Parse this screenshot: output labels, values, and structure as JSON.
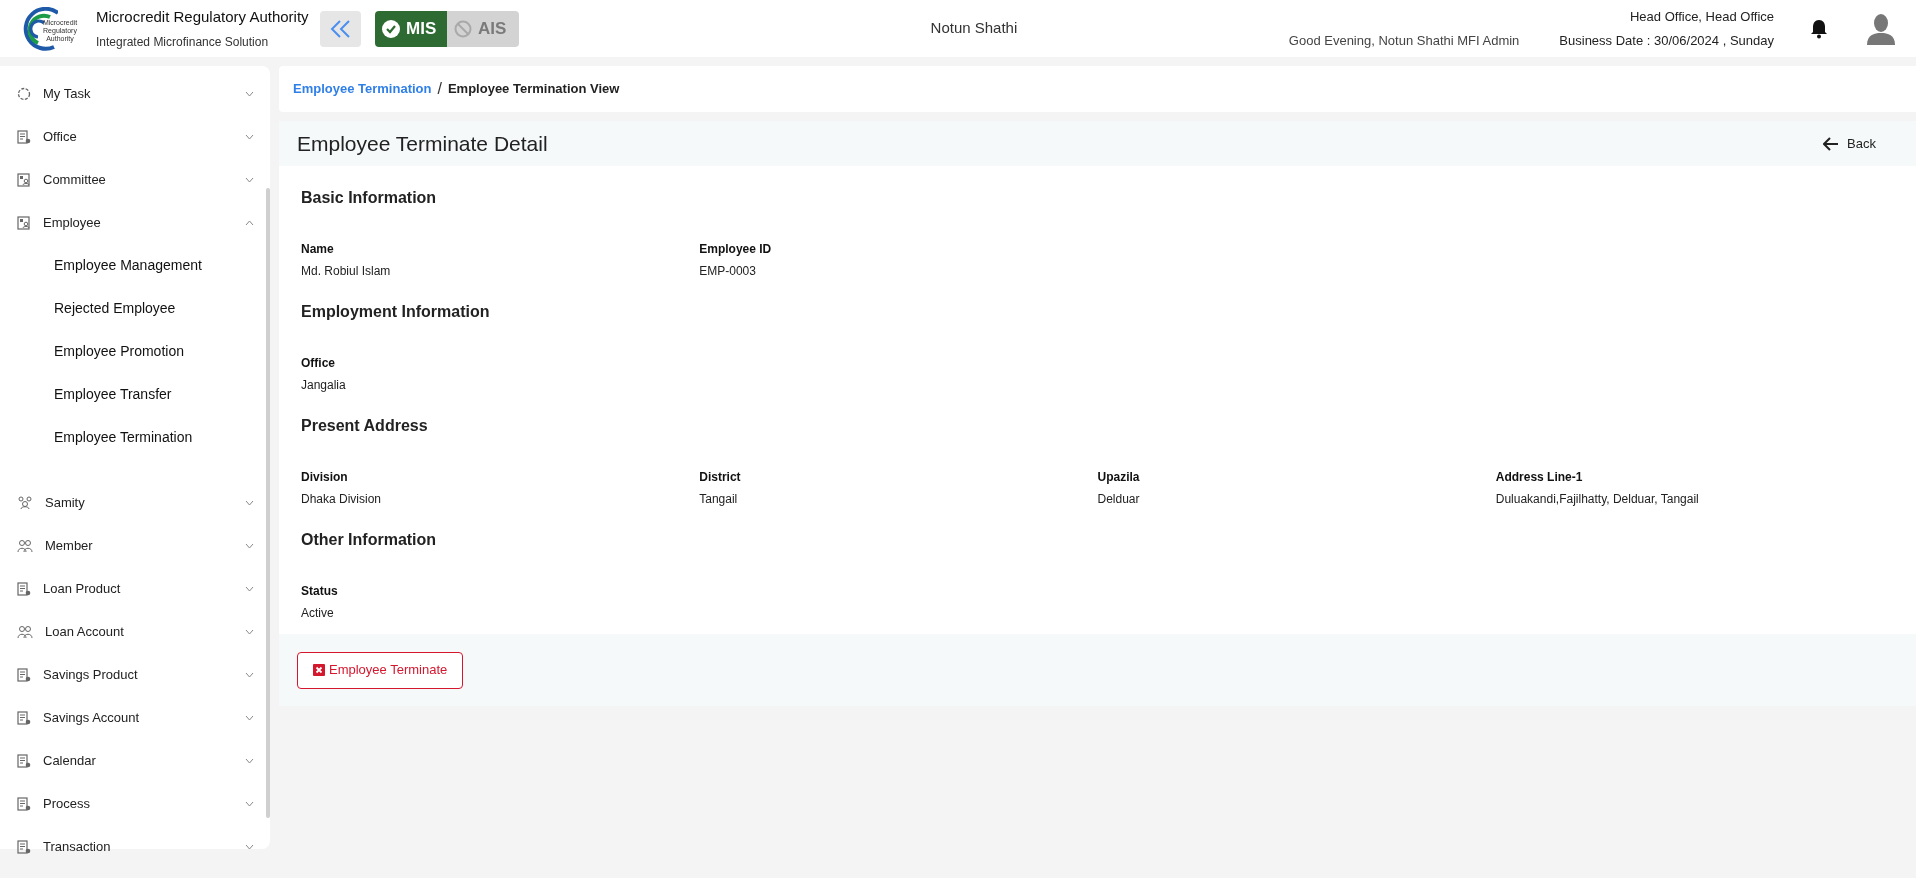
{
  "header": {
    "org_title": "Microcredit Regulatory Authority",
    "org_subtitle": "Integrated Microfinance Solution",
    "logo_text": "Microcredit Regulatory Authority",
    "modules": [
      {
        "label": "MIS",
        "selected": true
      },
      {
        "label": "AIS",
        "selected": false
      }
    ],
    "company": "Notun Shathi",
    "greeting": "Good Evening, Notun Shathi MFI Admin",
    "office": "Head Office, Head Office",
    "business_date": "Business Date : 30/06/2024 , Sunday"
  },
  "sidebar": {
    "items": [
      {
        "label": "My Task",
        "kind": "task",
        "expanded": false
      },
      {
        "label": "Office",
        "kind": "doc",
        "expanded": false
      },
      {
        "label": "Committee",
        "kind": "board",
        "expanded": false
      },
      {
        "label": "Employee",
        "kind": "board",
        "expanded": true,
        "children": [
          {
            "label": "Employee Management"
          },
          {
            "label": "Rejected Employee"
          },
          {
            "label": "Employee Promotion"
          },
          {
            "label": "Employee Transfer"
          },
          {
            "label": "Employee Termination"
          }
        ]
      },
      {
        "label": "Samity",
        "kind": "samity",
        "expanded": false
      },
      {
        "label": "Member",
        "kind": "people",
        "expanded": false
      },
      {
        "label": "Loan Product",
        "kind": "doc",
        "expanded": false
      },
      {
        "label": "Loan Account",
        "kind": "people",
        "expanded": false
      },
      {
        "label": "Savings Product",
        "kind": "doc",
        "expanded": false
      },
      {
        "label": "Savings Account",
        "kind": "doc",
        "expanded": false
      },
      {
        "label": "Calendar",
        "kind": "doc",
        "expanded": false
      },
      {
        "label": "Process",
        "kind": "doc",
        "expanded": false
      },
      {
        "label": "Transaction",
        "kind": "doc",
        "expanded": false
      }
    ]
  },
  "breadcrumb": [
    {
      "label": "Employee Termination",
      "link": true
    },
    {
      "label": "Employee Termination View",
      "link": false
    }
  ],
  "breadcrumb_separator": "/",
  "page_title": "Employee Terminate Detail",
  "back_label": "Back",
  "sections": [
    {
      "title": "Basic Information",
      "fields": [
        {
          "label": "Name",
          "value": "Md. Robiul Islam"
        },
        {
          "label": "Employee ID",
          "value": "EMP-0003"
        }
      ]
    },
    {
      "title": "Employment Information",
      "fields": [
        {
          "label": "Office",
          "value": "Jangalia"
        }
      ]
    },
    {
      "title": "Present Address",
      "fields": [
        {
          "label": "Division",
          "value": "Dhaka Division"
        },
        {
          "label": "District",
          "value": "Tangail"
        },
        {
          "label": "Upazila",
          "value": "Delduar"
        },
        {
          "label": "Address Line-1",
          "value": "Duluakandi,Fajilhatty, Delduar, Tangail"
        }
      ]
    },
    {
      "title": "Other Information",
      "fields": [
        {
          "label": "Status",
          "value": "Active"
        }
      ]
    }
  ],
  "action_button": "Employee Terminate"
}
